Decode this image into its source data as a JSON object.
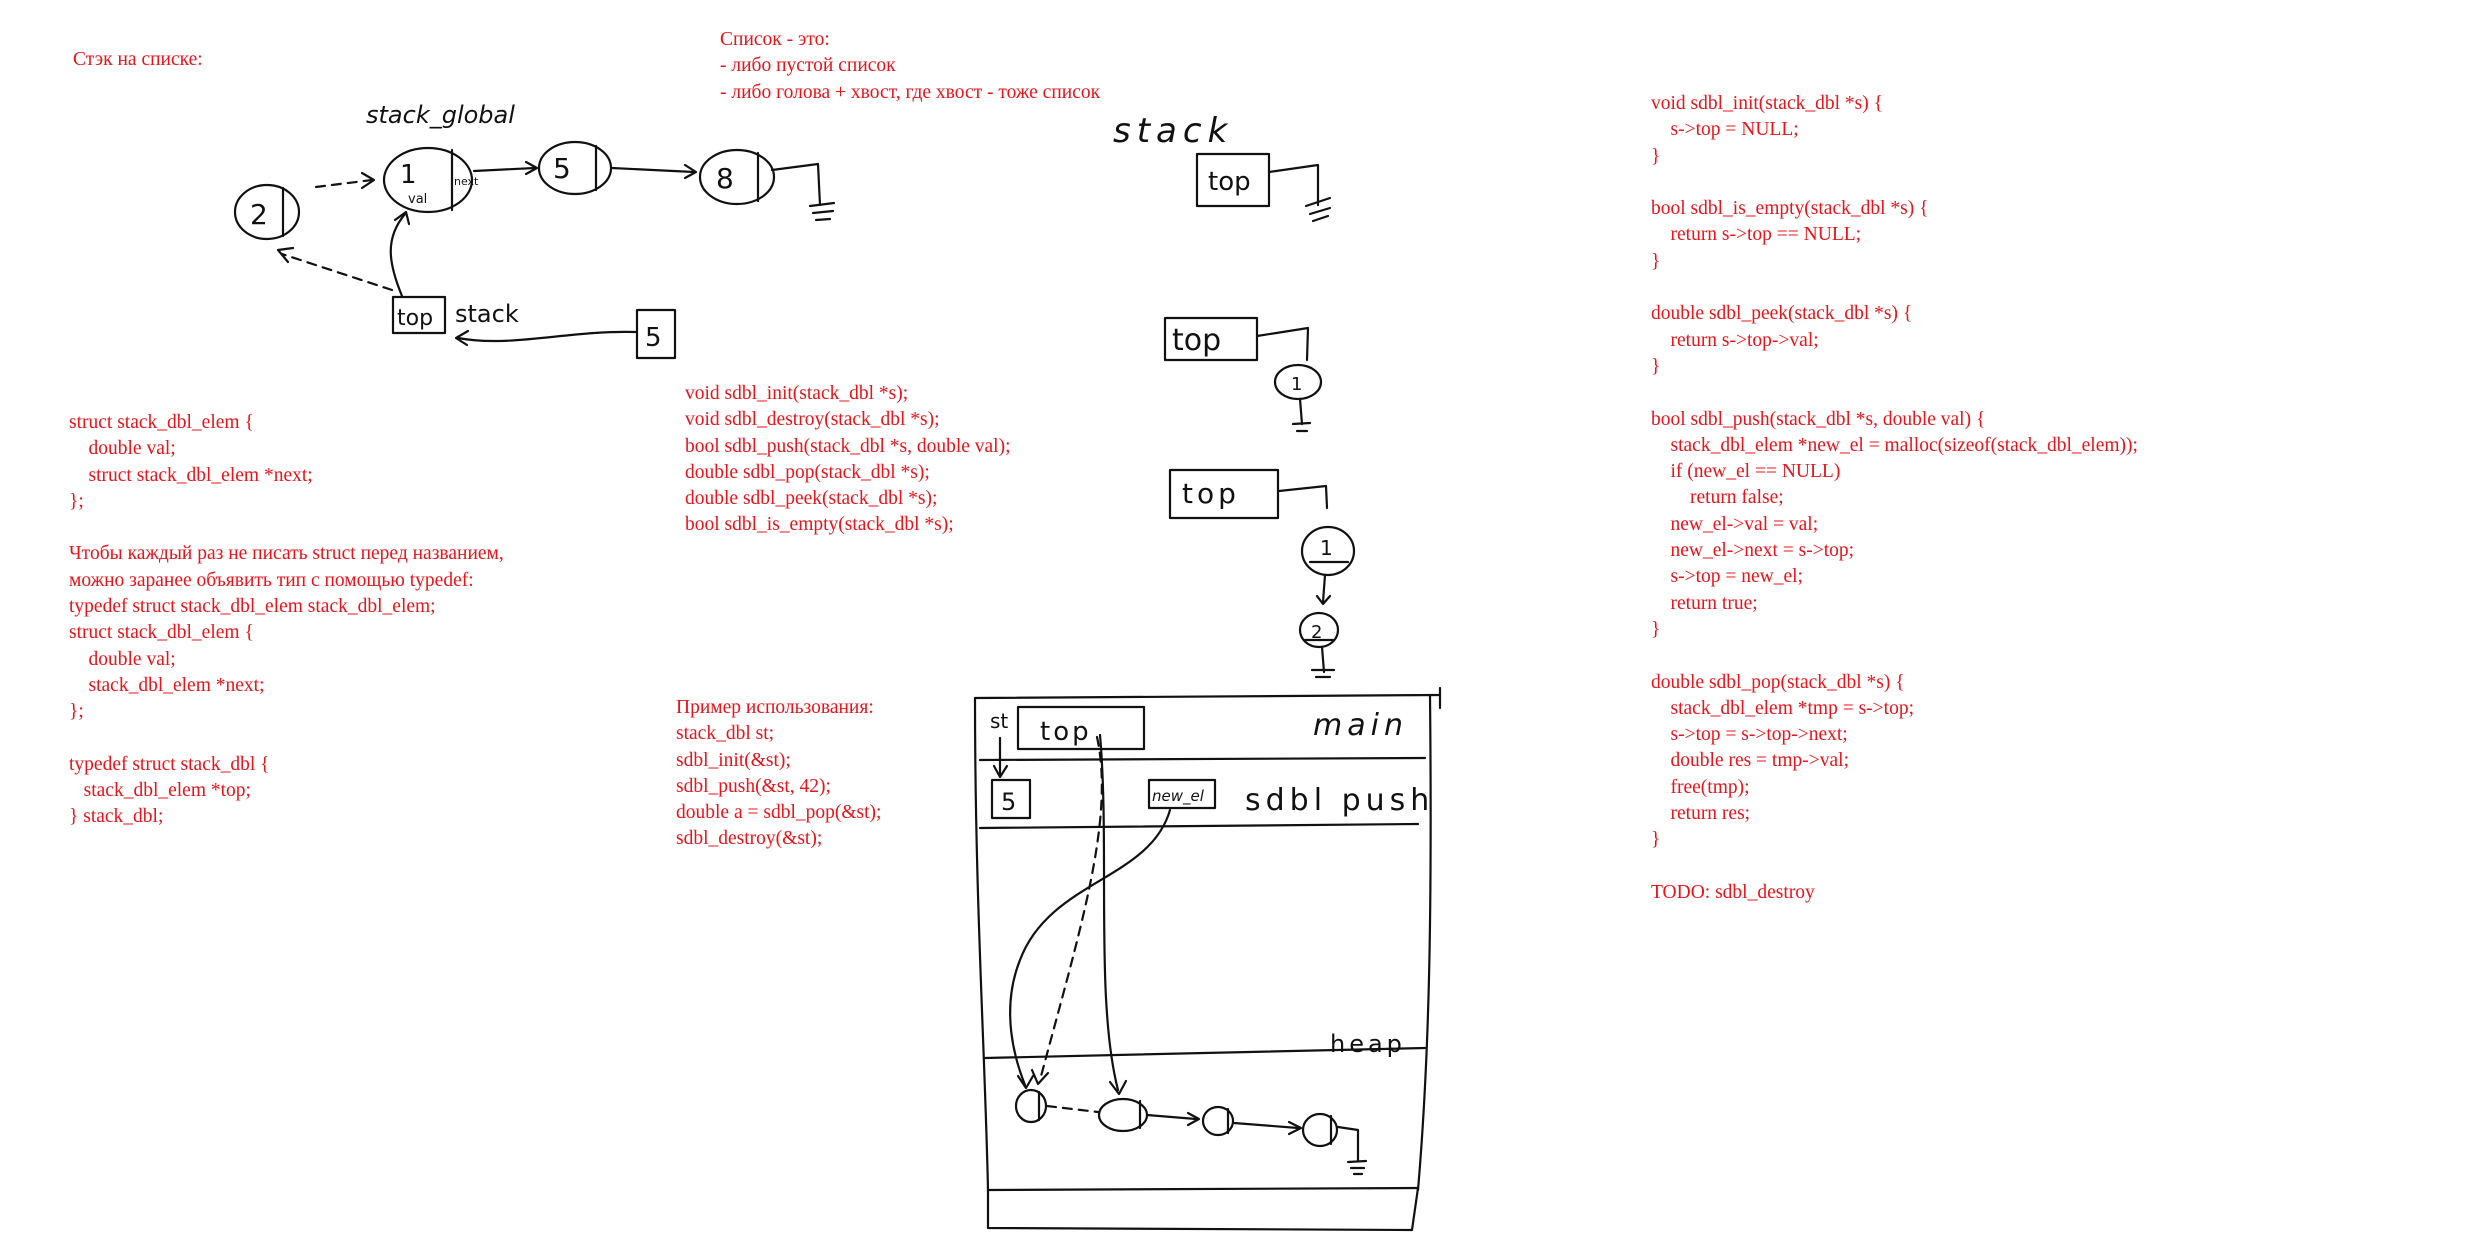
{
  "title_stack_on_list": "Стэк на списке:",
  "list_definition": [
    "Список - это:",
    "- либо пустой список",
    "- либо голова + хвост, где хвост - тоже список"
  ],
  "struct_block": [
    "struct stack_dbl_elem {",
    "    double val;",
    "    struct stack_dbl_elem *next;",
    "};",
    "",
    "Чтобы каждый раз не писать struct перед названием,",
    "можно заранее объявить тип с помощью typedef:",
    "typedef struct stack_dbl_elem stack_dbl_elem;",
    "struct stack_dbl_elem {",
    "    double val;",
    "    stack_dbl_elem *next;",
    "};",
    "",
    "typedef struct stack_dbl {",
    "   stack_dbl_elem *top;",
    "} stack_dbl;"
  ],
  "api_block": [
    "void sdbl_init(stack_dbl *s);",
    "void sdbl_destroy(stack_dbl *s);",
    "bool sdbl_push(stack_dbl *s, double val);",
    "double sdbl_pop(stack_dbl *s);",
    "double sdbl_peek(stack_dbl *s);",
    "bool sdbl_is_empty(stack_dbl *s);"
  ],
  "usage_block": [
    "Пример использования:",
    "stack_dbl st;",
    "sdbl_init(&st);",
    "sdbl_push(&st, 42);",
    "double a = sdbl_pop(&st);",
    "sdbl_destroy(&st);"
  ],
  "impl_block": [
    "void sdbl_init(stack_dbl *s) {",
    "    s->top = NULL;",
    "}",
    "",
    "bool sdbl_is_empty(stack_dbl *s) {",
    "    return s->top == NULL;",
    "}",
    "",
    "double sdbl_peek(stack_dbl *s) {",
    "    return s->top->val;",
    "}",
    "",
    "bool sdbl_push(stack_dbl *s, double val) {",
    "    stack_dbl_elem *new_el = malloc(sizeof(stack_dbl_elem));",
    "    if (new_el == NULL)",
    "        return false;",
    "    new_el->val = val;",
    "    new_el->next = s->top;",
    "    s->top = new_el;",
    "    return true;",
    "}",
    "",
    "double sdbl_pop(stack_dbl *s) {",
    "    stack_dbl_elem *tmp = s->top;",
    "    s->top = s->top->next;",
    "    double res = tmp->val;",
    "    free(tmp);",
    "    return res;",
    "}",
    "",
    "TODO: sdbl_destroy"
  ],
  "sketch_labels": {
    "stack_global": "stack_global",
    "node_2": "2",
    "node_1": "1",
    "node_5": "5",
    "node_8": "8",
    "val": "val",
    "next": "next",
    "top_box": "top",
    "stack_word": "stack",
    "push_value": "5",
    "stack_heading": "stack",
    "top_1": "top",
    "top_2": "top",
    "top_3": "top",
    "one_a": "1",
    "one_b": "1",
    "two": "2",
    "memory_st": "st",
    "memory_top": "top",
    "memory_main": "main",
    "memory_5": "5",
    "memory_new_el": "new_el",
    "memory_sdbl_push": "sdbl push",
    "memory_heap": "heap"
  },
  "colors": {
    "text": "#e8141a",
    "ink": "#111111",
    "background": "#ffffff"
  }
}
